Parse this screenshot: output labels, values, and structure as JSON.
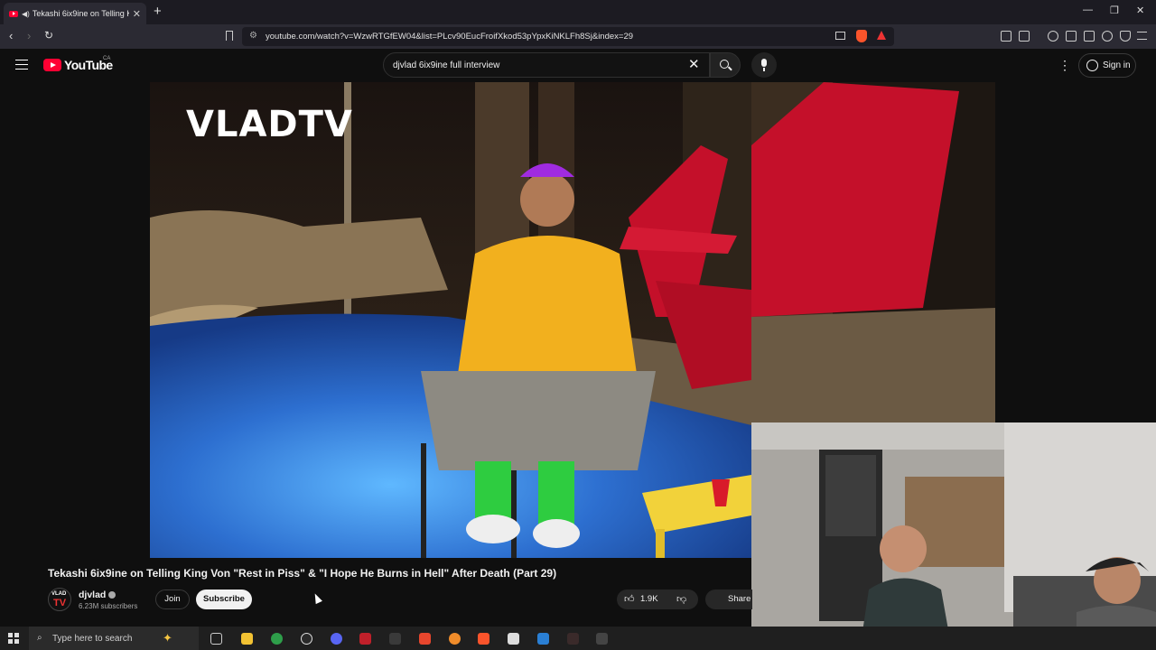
{
  "browser": {
    "tab_title": "Tekashi 6ix9ine on Telling King Von \"Rest in Piss\" & \"I Hope He Burns in Hell\" After Death (Part 29)",
    "tab_title_short": "Tekashi 6ix9ine on Telling Kin",
    "tab_close": "✕",
    "new_tab": "+",
    "url": "youtube.com/watch?v=WzwRTGfEW04&list=PLcv90EucFroifXkod53pYpxKiNKLFh8Sj&index=29",
    "window_controls": [
      "—",
      "❐",
      "✕"
    ]
  },
  "youtube": {
    "logo_text": "YouTube",
    "country_code": "CA",
    "search_value": "djvlad 6ix9ine full interview",
    "sign_in": "Sign in"
  },
  "video": {
    "watermark": "VLADTV",
    "title": "Tekashi 6ix9ine on Telling King Von \"Rest in Piss\" & \"I Hope He Burns in Hell\" After Death (Part 29)",
    "channel": {
      "avatar_line1": "VLAD",
      "avatar_line2": "TV",
      "name": "djvlad",
      "subscribers": "6.23M subscribers"
    },
    "join_label": "Join",
    "subscribe_label": "Subscribe",
    "likes": "1.9K",
    "share_label": "Share"
  },
  "taskbar": {
    "search_placeholder": "Type here to search"
  },
  "colors": {
    "youtube_red": "#ff0033",
    "background": "#0f0f0f",
    "browser_chrome": "#2b2a33"
  }
}
